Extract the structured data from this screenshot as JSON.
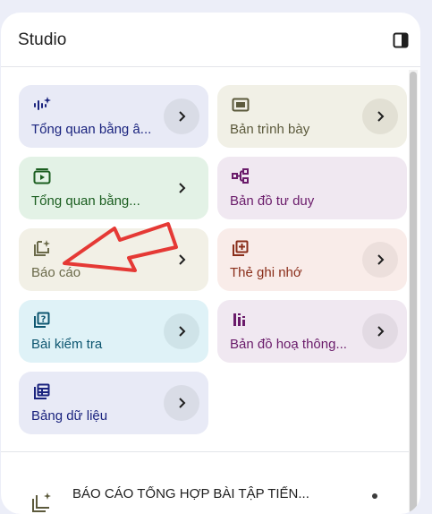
{
  "studio": {
    "title": "Studio",
    "collapse_icon": "panel-collapse-icon"
  },
  "cards": [
    {
      "key": "audio-overview",
      "label": "Tổng quan bằng â...",
      "icon": "audio-sparkle-icon",
      "bg": "#e8eaf6",
      "fg": "#1a237e",
      "arrow_bg": "#d9dce6"
    },
    {
      "key": "slide-deck",
      "label": "Bản trình bày",
      "icon": "slides-icon",
      "bg": "#f1f0e6",
      "fg": "#5c5a3c",
      "arrow_bg": "#e2e0d4"
    },
    {
      "key": "video-overview",
      "label": "Tổng quan bằng...",
      "icon": "video-icon",
      "bg": "#e3f2e6",
      "fg": "#1b5e20",
      "arrow_bg": "#e3f2e6"
    },
    {
      "key": "mind-map",
      "label": "Bản đồ tư duy",
      "icon": "mind-map-icon",
      "bg": "#f0e8f1",
      "fg": "#6a1b6a",
      "arrow_bg": "#f0e8f1"
    },
    {
      "key": "report",
      "label": "Báo cáo",
      "icon": "report-sparkle-icon",
      "bg": "#f2f0e6",
      "fg": "#6b6a4a",
      "arrow_bg": "#f2f0e6"
    },
    {
      "key": "flashcards",
      "label": "Thẻ ghi nhớ",
      "icon": "flashcards-icon",
      "bg": "#f9ece9",
      "fg": "#8a2e1a",
      "arrow_bg": "#ecdfdc"
    },
    {
      "key": "quiz",
      "label": "Bài kiểm tra",
      "icon": "quiz-icon",
      "bg": "#dff2f7",
      "fg": "#0d5670",
      "arrow_bg": "#cfe3e8"
    },
    {
      "key": "infographic",
      "label": "Bản đồ hoạ thông...",
      "icon": "infographic-icon",
      "bg": "#f0e8f1",
      "fg": "#6a1b6a",
      "arrow_bg": "#e2dae3"
    },
    {
      "key": "data-table",
      "label": "Bảng dữ liệu",
      "icon": "data-table-icon",
      "bg": "#e8eaf6",
      "fg": "#1a237e",
      "arrow_bg": "#d9dce6"
    }
  ],
  "report_item": {
    "title": "BÁO CÁO TỔNG HỢP BÀI TẬP TIẾN...",
    "icon": "report-sparkle-icon"
  },
  "annotation": {
    "arrow_color": "#e53935",
    "icon": "red-arrow-annotation"
  }
}
